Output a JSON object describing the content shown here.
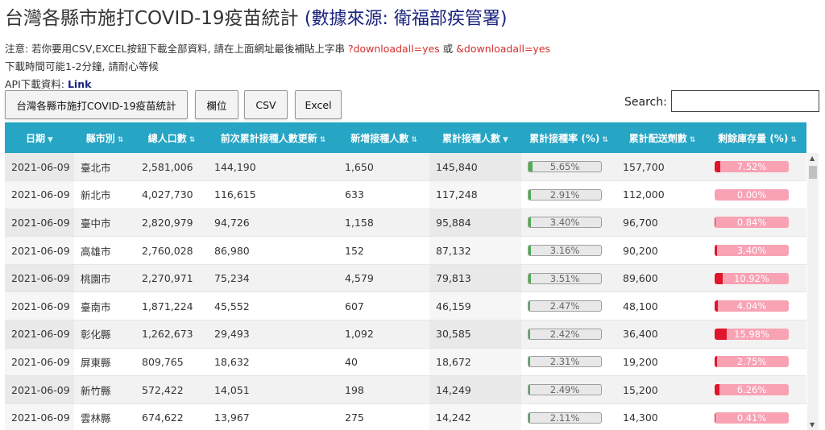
{
  "header": {
    "title": "台灣各縣市施打COVID-19疫苗統計",
    "source": "(數據來源: 衛福部疾管署)"
  },
  "notes": {
    "line1_prefix": "注意: 若你要用CSV,EXCEL按鈕下載全部資料, 請在上面網址最後補貼上字串 ",
    "param1": "?downloadall=yes",
    "or": " 或 ",
    "param2": "&downloadall=yes",
    "line2_a": "下載時間可能",
    "line2_b": "1-2",
    "line2_c": "分鐘, 請耐心等候",
    "api_label": "API下載資料: ",
    "api_link": "Link"
  },
  "toolbar": {
    "title_button": "台灣各縣市施打COVID-19疫苗統計",
    "columns_button": "欄位",
    "csv_button": "CSV",
    "excel_button": "Excel",
    "search_label": "Search:",
    "search_value": ""
  },
  "colors": {
    "header_bg": "#26a5c4",
    "rate_bar": "#4caf50",
    "stock_bar": "#e0152b",
    "stock_bar_bg": "#f8a2b4"
  },
  "table": {
    "columns": [
      "日期",
      "縣市別",
      "總人口數",
      "前次累計接種人數更新",
      "新增接種人數",
      "累計接種人數",
      "累計接種率 (%)",
      "累計配送劑數",
      "剩餘庫存量 (%)"
    ],
    "sort_icon": "sort-icon",
    "rows": [
      {
        "date": "2021-06-09",
        "city": "臺北市",
        "pop": "2,581,006",
        "prev": "144,190",
        "new": "1,650",
        "total": "145,840",
        "rate": "5.65%",
        "rate_v": 5.65,
        "dist": "157,700",
        "stock": "7.52%",
        "stock_v": 7.52
      },
      {
        "date": "2021-06-09",
        "city": "新北市",
        "pop": "4,027,730",
        "prev": "116,615",
        "new": "633",
        "total": "117,248",
        "rate": "2.91%",
        "rate_v": 2.91,
        "dist": "112,000",
        "stock": "0.00%",
        "stock_v": 0.0
      },
      {
        "date": "2021-06-09",
        "city": "臺中市",
        "pop": "2,820,979",
        "prev": "94,726",
        "new": "1,158",
        "total": "95,884",
        "rate": "3.40%",
        "rate_v": 3.4,
        "dist": "96,700",
        "stock": "0.84%",
        "stock_v": 0.84
      },
      {
        "date": "2021-06-09",
        "city": "高雄市",
        "pop": "2,760,028",
        "prev": "86,980",
        "new": "152",
        "total": "87,132",
        "rate": "3.16%",
        "rate_v": 3.16,
        "dist": "90,200",
        "stock": "3.40%",
        "stock_v": 3.4
      },
      {
        "date": "2021-06-09",
        "city": "桃園市",
        "pop": "2,270,971",
        "prev": "75,234",
        "new": "4,579",
        "total": "79,813",
        "rate": "3.51%",
        "rate_v": 3.51,
        "dist": "89,600",
        "stock": "10.92%",
        "stock_v": 10.92
      },
      {
        "date": "2021-06-09",
        "city": "臺南市",
        "pop": "1,871,224",
        "prev": "45,552",
        "new": "607",
        "total": "46,159",
        "rate": "2.47%",
        "rate_v": 2.47,
        "dist": "48,100",
        "stock": "4.04%",
        "stock_v": 4.04
      },
      {
        "date": "2021-06-09",
        "city": "彰化縣",
        "pop": "1,262,673",
        "prev": "29,493",
        "new": "1,092",
        "total": "30,585",
        "rate": "2.42%",
        "rate_v": 2.42,
        "dist": "36,400",
        "stock": "15.98%",
        "stock_v": 15.98
      },
      {
        "date": "2021-06-09",
        "city": "屏東縣",
        "pop": "809,765",
        "prev": "18,632",
        "new": "40",
        "total": "18,672",
        "rate": "2.31%",
        "rate_v": 2.31,
        "dist": "19,200",
        "stock": "2.75%",
        "stock_v": 2.75
      },
      {
        "date": "2021-06-09",
        "city": "新竹縣",
        "pop": "572,422",
        "prev": "14,051",
        "new": "198",
        "total": "14,249",
        "rate": "2.49%",
        "rate_v": 2.49,
        "dist": "15,200",
        "stock": "6.26%",
        "stock_v": 6.26
      },
      {
        "date": "2021-06-09",
        "city": "雲林縣",
        "pop": "674,622",
        "prev": "13,967",
        "new": "275",
        "total": "14,242",
        "rate": "2.11%",
        "rate_v": 2.11,
        "dist": "14,300",
        "stock": "0.41%",
        "stock_v": 0.41
      }
    ]
  }
}
